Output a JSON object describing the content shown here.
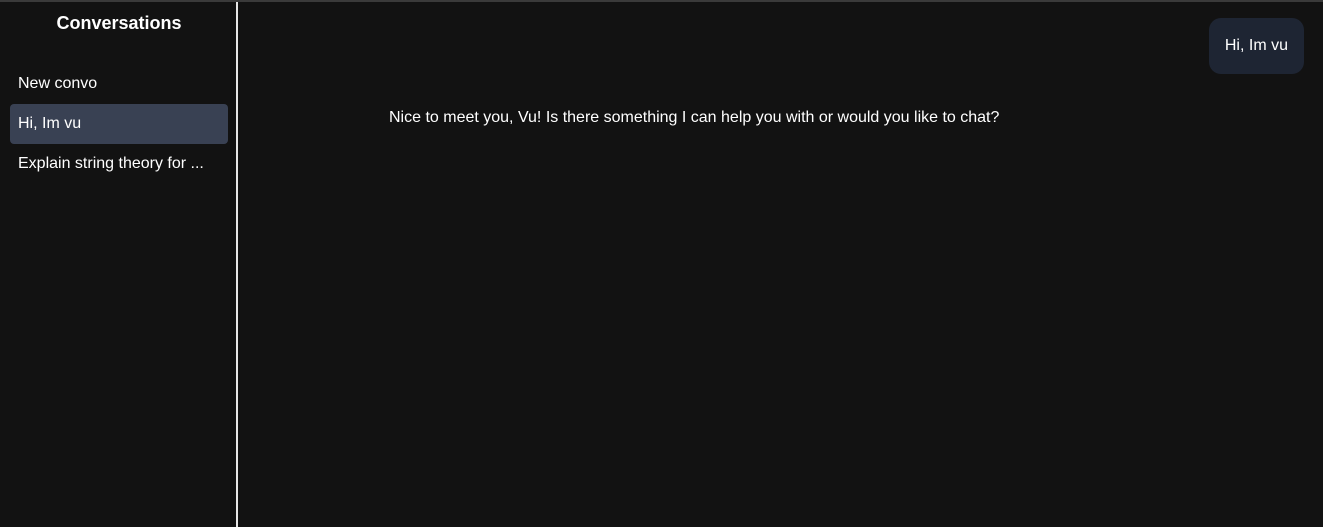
{
  "sidebar": {
    "title": "Conversations",
    "items": [
      {
        "label": "New convo",
        "active": false
      },
      {
        "label": "Hi, Im vu",
        "active": true
      },
      {
        "label": "Explain string theory for ...",
        "active": false
      }
    ]
  },
  "chat": {
    "user_message": "Hi, Im vu",
    "assistant_message": "Nice to meet you, Vu! Is there something I can help you with or would you like to chat?"
  },
  "colors": {
    "background": "#121212",
    "active_item": "#394153",
    "user_bubble": "#1e2533",
    "divider": "#e6e6e6"
  }
}
